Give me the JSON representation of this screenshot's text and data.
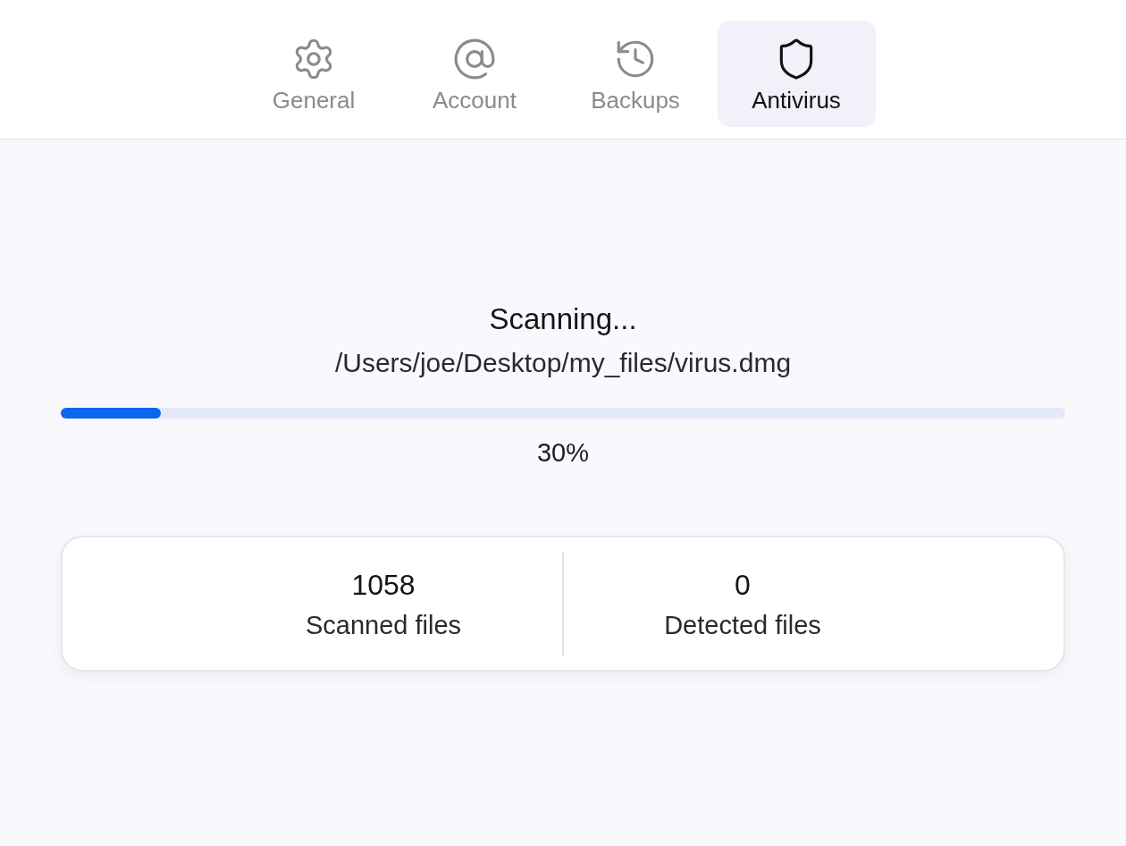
{
  "tabs": [
    {
      "label": "General",
      "selected": false
    },
    {
      "label": "Account",
      "selected": false
    },
    {
      "label": "Backups",
      "selected": false
    },
    {
      "label": "Antivirus",
      "selected": true
    }
  ],
  "scan": {
    "title": "Scanning...",
    "path": "/Users/joe/Desktop/my_files/virus.dmg",
    "progress": {
      "level": 0.1,
      "reading": "30%"
    }
  },
  "stats": [
    {
      "value": "1058",
      "label": "Scanned files"
    },
    {
      "value": "0",
      "label": "Detected files"
    }
  ]
}
